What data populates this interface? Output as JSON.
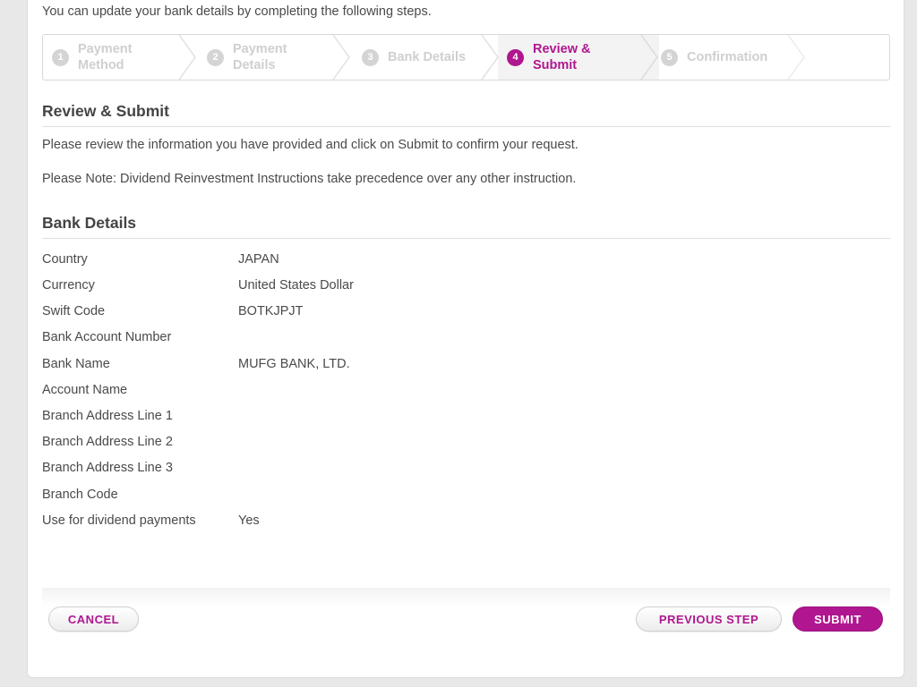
{
  "intro_text": "You can update your bank details by completing the following steps.",
  "steps": [
    {
      "num": "1",
      "line1": "Payment",
      "line2": "Method",
      "state": "inactive"
    },
    {
      "num": "2",
      "line1": "Payment",
      "line2": "Details",
      "state": "inactive"
    },
    {
      "num": "3",
      "line1": "Bank Details",
      "line2": "",
      "state": "inactive"
    },
    {
      "num": "4",
      "line1": "Review &",
      "line2": "Submit",
      "state": "active"
    },
    {
      "num": "5",
      "line1": "Confirmation",
      "line2": "",
      "state": "inactive"
    }
  ],
  "review": {
    "heading": "Review & Submit",
    "instruction": "Please review the information you have provided and click on Submit to confirm your request.",
    "note": "Please Note: Dividend Reinvestment Instructions take precedence over any other instruction."
  },
  "bank_details": {
    "heading": "Bank Details",
    "rows": [
      {
        "label": "Country",
        "value": "JAPAN"
      },
      {
        "label": "Currency",
        "value": "United States Dollar"
      },
      {
        "label": "Swift Code",
        "value": "BOTKJPJT"
      },
      {
        "label": "Bank Account Number",
        "value": ""
      },
      {
        "label": "Bank Name",
        "value": "MUFG BANK, LTD."
      },
      {
        "label": "Account Name",
        "value": ""
      },
      {
        "label": "Branch Address Line 1",
        "value": ""
      },
      {
        "label": "Branch Address Line 2",
        "value": ""
      },
      {
        "label": "Branch Address Line 3",
        "value": ""
      },
      {
        "label": "Branch Code",
        "value": ""
      },
      {
        "label": "Use for dividend payments",
        "value": "Yes"
      }
    ]
  },
  "buttons": {
    "cancel": "CANCEL",
    "previous": "PREVIOUS STEP",
    "submit": "SUBMIT"
  },
  "colors": {
    "accent": "#b0168f",
    "inactive_step": "#cfcfcf",
    "text": "#4a4a4a"
  }
}
